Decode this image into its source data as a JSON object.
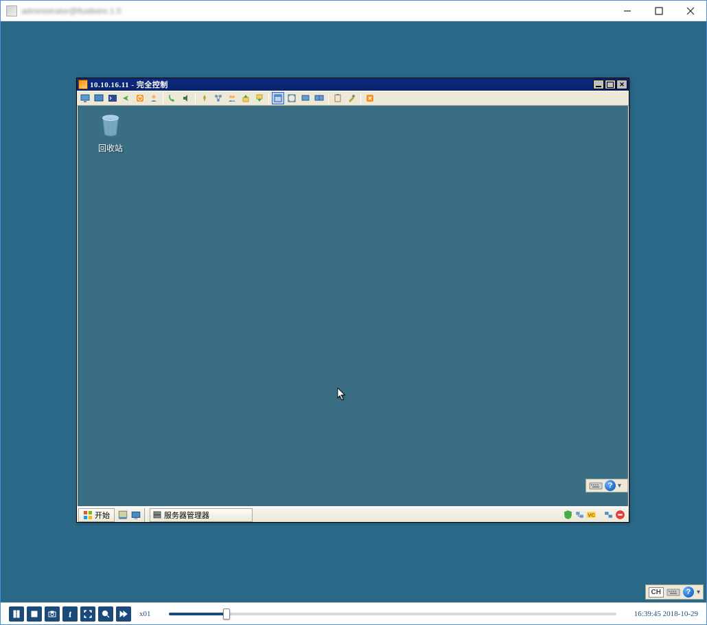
{
  "host": {
    "title": "administrator@fluidwire.1.0"
  },
  "inner_window": {
    "ip": "10.10.16.11",
    "separator": " - ",
    "mode": "完全控制"
  },
  "toolbar_icons": [
    "monitor-icon",
    "screen-icon",
    "terminal-icon",
    "send-icon",
    "power-icon",
    "user-icon",
    "phone-icon",
    "audio-icon",
    "pin-icon",
    "network-icon",
    "users-icon",
    "upload-icon",
    "download-icon",
    "window-icon",
    "fit-icon",
    "display1-icon",
    "display2-icon",
    "clipboard-icon",
    "tools-icon",
    "close-session-icon"
  ],
  "desktop": {
    "recycle_bin": "回收站"
  },
  "taskbar": {
    "start": "开始",
    "task1": "服务器管理器"
  },
  "outer_status": {
    "lang": "CH"
  },
  "player": {
    "speed": "x01",
    "time": "16:39:45",
    "date": "2018-10-29"
  }
}
